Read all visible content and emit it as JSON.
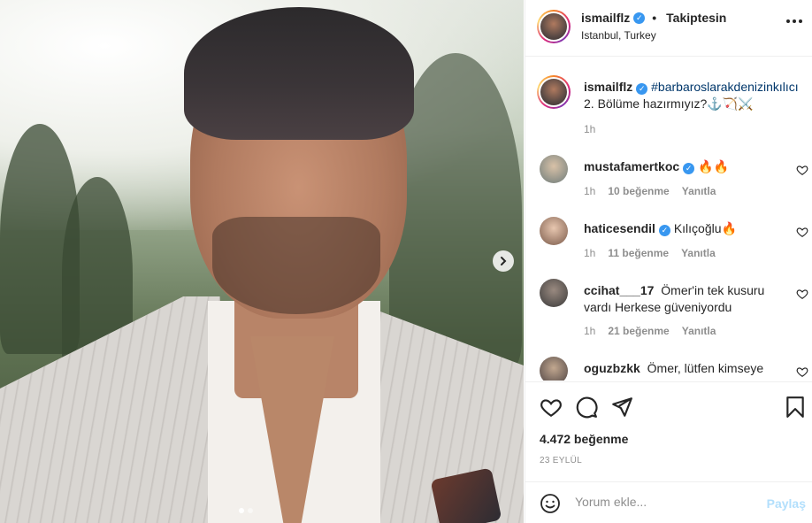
{
  "post": {
    "next_icon": "chevron-right-icon",
    "slide_count": 2,
    "active_slide": 1
  },
  "header": {
    "username": "ismailflz",
    "separator": "•",
    "follow_status": "Takiptesin",
    "location": "Istanbul, Turkey",
    "more_icon": "more-horizontal-icon"
  },
  "caption": {
    "username": "ismailflz",
    "hashtag": "#barbaroslarakdenizinkılıcı",
    "text": "2. Bölüme hazırmıyız?⚓️🏹⚔️",
    "time": "1h"
  },
  "comments": [
    {
      "username": "mustafamertkoc",
      "verified": true,
      "text": "🔥🔥",
      "time": "1h",
      "likes": "10 beğenme",
      "reply": "Yanıtla"
    },
    {
      "username": "haticesendil",
      "verified": true,
      "text": "Kılıçoğlu🔥",
      "time": "1h",
      "likes": "11 beğenme",
      "reply": "Yanıtla"
    },
    {
      "username": "ccihat___17",
      "verified": false,
      "text": "Ömer'in tek kusuru vardı Herkese güveniyordu",
      "time": "1h",
      "likes": "21 beğenme",
      "reply": "Yanıtla"
    },
    {
      "username": "oguzbzkk",
      "verified": false,
      "text": "Ömer, lütfen kimseye güvenme. Güvendiklerin sırtından vuruyor",
      "time": "",
      "likes": "",
      "reply": ""
    }
  ],
  "actions": {
    "like_icon": "heart-icon",
    "comment_icon": "comment-icon",
    "share_icon": "send-icon",
    "save_icon": "bookmark-icon"
  },
  "likes": "4.472 beğenme",
  "date": "23 EYLÜL",
  "add_comment": {
    "placeholder": "Yorum ekle...",
    "post_label": "Paylaş",
    "emoji_icon": "smiley-icon"
  },
  "colors": {
    "verified": "#3897f0",
    "hashtag": "#00376b",
    "muted": "#8e8e8e",
    "post_disabled": "#b2dffc"
  }
}
